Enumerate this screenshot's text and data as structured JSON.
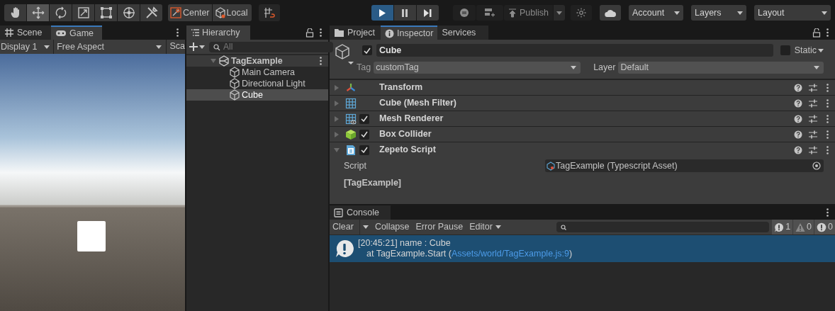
{
  "toolbar": {
    "tools": [
      {
        "kind": "hand",
        "selected": false
      },
      {
        "kind": "move",
        "selected": true
      },
      {
        "kind": "rotate",
        "selected": false
      },
      {
        "kind": "scale",
        "selected": false
      },
      {
        "kind": "rect",
        "selected": false
      },
      {
        "kind": "transform",
        "selected": false
      },
      {
        "kind": "custom",
        "selected": false
      }
    ],
    "pivot": "Center",
    "space": "Local",
    "playback": [
      {
        "kind": "play",
        "selected": true
      },
      {
        "kind": "pause",
        "selected": false
      },
      {
        "kind": "step",
        "selected": false
      }
    ],
    "publish": "Publish",
    "account": "Account",
    "layers": "Layers",
    "layout": "Layout"
  },
  "game": {
    "tabs": [
      {
        "label": "Scene",
        "kind": "scene",
        "selected": false
      },
      {
        "label": "Game",
        "kind": "game",
        "selected": true
      }
    ],
    "display": "Display 1",
    "aspect": "Free Aspect",
    "scale": "Sca"
  },
  "hierarchy": {
    "title": "Hierarchy",
    "search_placeholder": "All",
    "tree": [
      {
        "label": "TagExample",
        "kind": "scene",
        "expanded": true,
        "selected": false,
        "children": [
          {
            "label": "Main Camera",
            "kind": "object",
            "selected": false
          },
          {
            "label": "Directional Light",
            "kind": "object",
            "selected": false
          },
          {
            "label": "Cube",
            "kind": "object",
            "selected": true
          }
        ]
      }
    ]
  },
  "inspector": {
    "tabs": [
      {
        "label": "Project",
        "kind": "folder",
        "selected": false
      },
      {
        "label": "Inspector",
        "kind": "info",
        "selected": true
      },
      {
        "label": "Services",
        "kind": "none",
        "selected": false
      }
    ],
    "object": {
      "active": true,
      "name": "Cube",
      "static_label": "Static",
      "static": false,
      "tag_label": "Tag",
      "tag": "customTag",
      "layer_label": "Layer",
      "layer": "Default"
    },
    "components": [
      {
        "name": "Transform",
        "kind": "transform",
        "expanded": false
      },
      {
        "name": "Cube (Mesh Filter)",
        "kind": "mesh_filter",
        "expanded": false
      },
      {
        "name": "Mesh Renderer",
        "kind": "mesh_renderer",
        "expanded": false,
        "enabled": true
      },
      {
        "name": "Box Collider",
        "kind": "box_collider",
        "expanded": false,
        "enabled": true
      },
      {
        "name": "Zepeto Script",
        "kind": "script",
        "expanded": true,
        "enabled": true
      }
    ],
    "script_label": "Script",
    "script_value": "TagExample (Typescript Asset)",
    "script_header": "[TagExample]"
  },
  "console": {
    "title": "Console",
    "buttons": [
      {
        "label": "Clear",
        "kind": "dropdown",
        "selected": false
      },
      {
        "label": "Collapse",
        "kind": "toggle",
        "selected": false
      },
      {
        "label": "Error Pause",
        "kind": "toggle",
        "selected": false
      },
      {
        "label": "Editor",
        "kind": "menu",
        "selected": false
      }
    ],
    "counts": [
      {
        "kind": "log",
        "count": "1",
        "selected": true
      },
      {
        "kind": "warning",
        "count": "0",
        "selected": true
      },
      {
        "kind": "error",
        "count": "0",
        "selected": true
      }
    ],
    "messages": [
      {
        "line": "[20:45:21] name : Cube",
        "trace": "at TagExample.Start (",
        "link": "Assets/world/TagExample.js:9",
        "trace_end": ")",
        "selected": true
      }
    ]
  }
}
